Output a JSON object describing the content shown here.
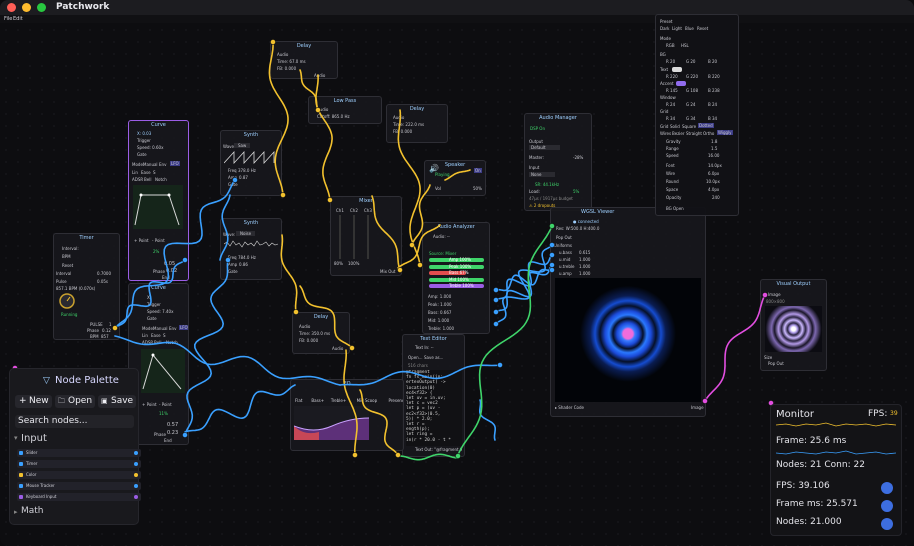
{
  "app": {
    "title": "Patchwork",
    "menu": [
      "File",
      "Edit"
    ]
  },
  "colors": {
    "accent": "#3d6ee0",
    "wire_blue": "#3aa0ff",
    "wire_yellow": "#f2c12e",
    "wire_green": "#3fd46a",
    "wire_magenta": "#e24ee0",
    "canvas": "#0d0d10"
  },
  "nodes": {
    "curve1": {
      "title": "Curve",
      "x_label": "X: 0.03",
      "trigger": "Trigger",
      "speed": "Speed: 0.60x",
      "gate": "Gate",
      "modes": [
        "Mode:",
        "Manual",
        "Env",
        "LFO"
      ],
      "shapes": [
        "Lin",
        "Ease",
        "S"
      ],
      "shapes2": [
        "ADSR",
        "Bell",
        "Notch"
      ],
      "point_add": "+ Point",
      "point_rem": "- Point",
      "pct": "2%",
      "phase_label": "Phase",
      "phase_val": "0.02",
      "end_label": "End",
      "end_val": "0",
      "val": "0.05"
    },
    "curve2": {
      "title": "Curve",
      "x_label": "X:",
      "trigger": "Trigger",
      "speed": "Speed: 7.40x",
      "gate": "Gate",
      "modes": [
        "Mode:",
        "Manual",
        "Env",
        "LFO"
      ],
      "shapes": [
        "Lin",
        "Ease",
        "S"
      ],
      "shapes2": [
        "ADSR",
        "Bell",
        "Notch"
      ],
      "point_add": "+ Point",
      "point_rem": "- Point",
      "pct": "11%",
      "phase_label": "Phase",
      "phase_val": "0.23",
      "end_label": "End",
      "end_val": "0",
      "val": "0.57"
    },
    "timer": {
      "title": "Timer",
      "interval": "Interval:",
      "bpm": "BPM",
      "reset": "Reset",
      "interval_label": "Interval",
      "interval_val": "0.7000",
      "pulse_label": "Pulse",
      "pulse_val": "0.05s",
      "bpm_text": "857.1 BPM (0.070s)",
      "running": "Running",
      "pulse_out": "PULSE",
      "pulse_out_val": "1",
      "phase_out": "Phase",
      "phase_out_val": "0.12",
      "bpm_out": "BPM",
      "bpm_out_val": "857"
    },
    "synth1": {
      "title": "Synth",
      "wave_label": "Wave:",
      "wave_val": "Saw",
      "freq_label": "Freq",
      "freq_val": "378.0 Hz",
      "amp_label": "Amp",
      "amp_val": "0.87",
      "gate_label": "Gate"
    },
    "synth2": {
      "title": "Synth",
      "wave_label": "Wave:",
      "wave_val": "Noise",
      "freq_label": "Freq",
      "freq_val": "784.0 Hz",
      "amp_label": "Amp",
      "amp_val": "0.86",
      "gate_label": "Gate"
    },
    "delay1": {
      "title": "Delay",
      "audio": "Audio",
      "time": "Time: 67.0 ms",
      "fb": "FB: 0.000",
      "out": "Audio"
    },
    "delay2": {
      "title": "Delay",
      "audio": "Audio",
      "time": "Time: 222.0 ms",
      "fb": "FB: 0.000",
      "out": "Audio"
    },
    "delay3": {
      "title": "Delay",
      "audio": "Audio",
      "time": "Time: 350.0 ms",
      "fb": "FB: 0.000",
      "out": "Audio"
    },
    "lowpass": {
      "title": "Low Pass",
      "audio": "Audio",
      "cutoff": "Cutoff: 865.0 Hz",
      "out": "Audio"
    },
    "mixer": {
      "title": "Mixer",
      "ch1": "Ch1",
      "ch2": "Ch2",
      "ch3": "Ch3",
      "pct1": "80%",
      "pct2": "100%",
      "out": "Mix Out"
    },
    "speaker": {
      "title": "Speaker",
      "state": "Playing",
      "on": "On",
      "vol": "Vol",
      "vol_val": "50%"
    },
    "analyzer": {
      "title": "Audio Analyzer",
      "audio": "Audio: --",
      "source": "Source: Mixer",
      "bars": [
        {
          "label": "Amp",
          "val": "100%",
          "color": "#3fd46a",
          "w": 55
        },
        {
          "label": "Peak",
          "val": "100%",
          "color": "#3fd46a",
          "w": 55
        },
        {
          "label": "Bass",
          "val": "67%",
          "color": "#e24e4e",
          "w": 37
        },
        {
          "label": "Mid",
          "val": "100%",
          "color": "#3fd46a",
          "w": 55
        },
        {
          "label": "Treble",
          "val": "100%",
          "color": "#9b5de5",
          "w": 55
        }
      ],
      "readouts": [
        "Amp: 1.000",
        "Peak: 1.000",
        "Bass: 0.667",
        "Mid: 1.000",
        "Treble: 1.000"
      ]
    },
    "audio_manager": {
      "title": "Audio Manager",
      "dsp": "DSP On",
      "output": "Output",
      "output_val": "Default",
      "master": "Master:",
      "master_val": "-28%",
      "input": "Input",
      "input_val": "None",
      "sr": "SR: 44.1kHz",
      "load": "Load:",
      "load_val": "5%",
      "budget": "47µs / 1917µs budget",
      "warn": "⚠ 2 dropouts"
    },
    "wgsl": {
      "title": "WGSL Viewer",
      "status": "● connected",
      "res": "Res: W:500.0 H:400.0",
      "popout": "Pop Out",
      "uniforms": "Uniforms",
      "u": [
        {
          "name": "u.bass",
          "val": "0.615"
        },
        {
          "name": "u.mid",
          "val": "1.000"
        },
        {
          "name": "u.treble",
          "val": "1.000"
        },
        {
          "name": "u.amp",
          "val": "1.000"
        }
      ],
      "shader_code": "▸ Shader Code",
      "image_out": "Image"
    },
    "visual": {
      "title": "Visual Output",
      "image": "Image",
      "size": "800×800",
      "size_label": "Size",
      "popout": "Pop Out"
    },
    "texteditor": {
      "title": "Text Editor",
      "text_in": "Text In: --",
      "open": "Open...",
      "save": "Save as...",
      "chars": "516 chars",
      "code": [
        "@fragment",
        "fn fs_main(in:",
        "ertexOutput) ->",
        "location(0)",
        "ec4<f32> {",
        "let uv = in.uv;",
        "let c = vec2",
        "let p = (uv -",
        "ec2<f32>(0.5,",
        "5)) * 2.0;",
        "let r =",
        "ength(p);",
        "let ring =",
        "in(r * 20.0 - t *"
      ],
      "text_out": "Text Out: \"@fragment fn_main(in:..."
    },
    "eq": {
      "title": "EQ",
      "tabs": [
        "Flat",
        "Bass+",
        "Treble+",
        "Mid Scoop",
        "Presence",
        "Warmth"
      ]
    },
    "preset": {
      "preset": "Preset",
      "themes": [
        "Dark",
        "Light",
        "Blue",
        "Reset"
      ],
      "mode": "Mode",
      "modes": [
        "RGB",
        "HSL"
      ],
      "bg": "BG",
      "bg_vals": [
        "R 20",
        "G 20",
        "B 20"
      ],
      "text": "Text",
      "text_vals": [
        "R 220",
        "G 220",
        "B 220"
      ],
      "accent": "Accent",
      "accent_vals": [
        "R 145",
        "G 108",
        "B 238"
      ],
      "window": "Window",
      "window_vals": [
        "R 24",
        "G 24",
        "B 24"
      ],
      "grid": "Grid",
      "grid_vals": [
        "R 34",
        "G 34",
        "B 34"
      ],
      "grid_styles": [
        "Grid",
        "Solid",
        "Square",
        "Dotted"
      ],
      "wire_styles": [
        "Wires",
        "Bezier",
        "Straight",
        "Ortho",
        "Wiggly"
      ],
      "gravity": "Gravity",
      "gravity_val": "1.8",
      "range": "Range",
      "range_val": "1.5",
      "speed": "Speed",
      "speed_val": "16.00",
      "font": "Font",
      "font_val": "14.0px",
      "wire": "Wire",
      "wire_val": "6.0px",
      "round": "Round",
      "round_val": "10.0px",
      "space": "Space",
      "space_val": "4.0px",
      "opacity": "Opacity",
      "opacity_val": "240",
      "bg_open": "BG",
      "bg_open_val": "Open"
    }
  },
  "palette": {
    "title": "Node Palette",
    "new": "New",
    "open": "Open",
    "save": "Save",
    "search": "Search nodes...",
    "section_input": "Input",
    "items": [
      {
        "label": "Slider",
        "color": "#3aa0ff"
      },
      {
        "label": "Timer",
        "color": "#3aa0ff"
      },
      {
        "label": "Color",
        "color": "#f2c12e"
      },
      {
        "label": "Mouse Tracker",
        "color": "#3aa0ff"
      },
      {
        "label": "Keyboard Input",
        "color": "#9b5de5"
      }
    ],
    "section_math": "Math"
  },
  "monitor": {
    "title": "Monitor",
    "fps_label": "FPS:",
    "fps_small": "39",
    "frame": "Frame: 25.6 ms",
    "nodes": "Nodes: 21 Conn: 22",
    "fps_text": "FPS: 39.106",
    "frame_text": "Frame ms: 25.571",
    "nodes_text": "Nodes: 21.000"
  }
}
